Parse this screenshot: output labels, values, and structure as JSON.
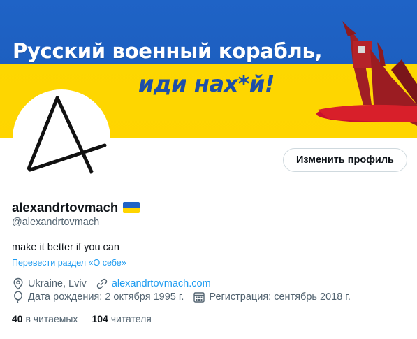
{
  "banner": {
    "line1": "Русский военный корабль,",
    "line2": "иди нах*й!"
  },
  "profile": {
    "edit_button": "Изменить профиль",
    "display_name": "alexandrtovmach",
    "flag_icon": "ukraine-flag-icon",
    "handle": "@alexandrtovmach",
    "bio": "make it better if you can",
    "translate_link": "Перевести раздел «О себе»",
    "location": "Ukraine, Lviv",
    "website": "alexandrtovmach.com",
    "birthday": "Дата рождения: 2 октября 1995 г.",
    "joined": "Регистрация: сентябрь 2018 г.",
    "following_count": "40",
    "following_label": "в читаемых",
    "followers_count": "104",
    "followers_label": "читателя"
  },
  "icons": {
    "location": "location-pin-icon",
    "link": "link-icon",
    "birthday": "balloon-icon",
    "joined": "calendar-icon"
  },
  "colors": {
    "banner_blue": "#1f63c6",
    "banner_yellow": "#ffd500",
    "link_blue": "#1d9bf0",
    "secondary_text": "#536471"
  }
}
